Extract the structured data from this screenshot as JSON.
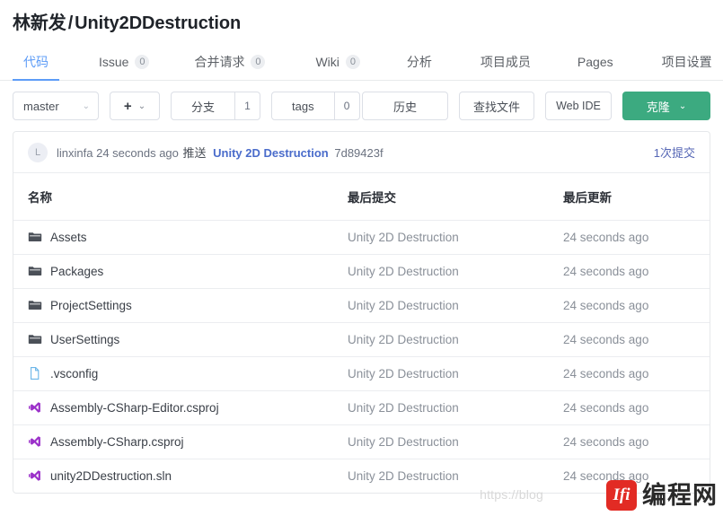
{
  "repo": {
    "owner": "林新发",
    "separator": "/",
    "name": "Unity2DDestruction"
  },
  "tabs": [
    {
      "label": "代码",
      "badge": null,
      "active": true
    },
    {
      "label": "Issue",
      "badge": "0",
      "active": false
    },
    {
      "label": "合并请求",
      "badge": "0",
      "active": false
    },
    {
      "label": "Wiki",
      "badge": "0",
      "active": false
    },
    {
      "label": "分析",
      "badge": null,
      "active": false
    },
    {
      "label": "项目成员",
      "badge": null,
      "active": false
    },
    {
      "label": "Pages",
      "badge": null,
      "active": false
    },
    {
      "label": "项目设置",
      "badge": null,
      "active": false
    }
  ],
  "toolbar": {
    "branch_value": "master",
    "branch_caret": "⌄",
    "add_plus": "+",
    "add_caret": "⌄",
    "branches_label": "分支",
    "branches_count": "1",
    "tags_label": "tags",
    "tags_count": "0",
    "history_label": "历史",
    "find_file_label": "查找文件",
    "web_ide_label": "Web IDE",
    "clone_label": "克隆",
    "clone_caret": "⌄",
    "clone_color": "#3caa80"
  },
  "commit_bar": {
    "avatar_initial": "L",
    "author": "linxinfa",
    "time": "24 seconds ago",
    "action": "推送",
    "message": "Unity 2D Destruction",
    "sha": "7d89423f",
    "commit_count": "1次提交"
  },
  "table": {
    "headers": {
      "name": "名称",
      "last_commit": "最后提交",
      "last_update": "最后更新"
    },
    "rows": [
      {
        "icon": "folder-icon",
        "name": "Assets",
        "last_commit": "Unity 2D Destruction",
        "last_update": "24 seconds ago"
      },
      {
        "icon": "folder-icon",
        "name": "Packages",
        "last_commit": "Unity 2D Destruction",
        "last_update": "24 seconds ago"
      },
      {
        "icon": "folder-icon",
        "name": "ProjectSettings",
        "last_commit": "Unity 2D Destruction",
        "last_update": "24 seconds ago"
      },
      {
        "icon": "folder-icon",
        "name": "UserSettings",
        "last_commit": "Unity 2D Destruction",
        "last_update": "24 seconds ago"
      },
      {
        "icon": "file-icon",
        "name": ".vsconfig",
        "last_commit": "Unity 2D Destruction",
        "last_update": "24 seconds ago"
      },
      {
        "icon": "vs-proj-icon",
        "name": "Assembly-CSharp-Editor.csproj",
        "last_commit": "Unity 2D Destruction",
        "last_update": "24 seconds ago"
      },
      {
        "icon": "vs-proj-icon",
        "name": "Assembly-CSharp.csproj",
        "last_commit": "Unity 2D Destruction",
        "last_update": "24 seconds ago"
      },
      {
        "icon": "vs-proj-icon",
        "name": "unity2DDestruction.sln",
        "last_commit": "Unity 2D Destruction",
        "last_update": "24 seconds ago"
      }
    ]
  },
  "watermark": {
    "url": "https://blog",
    "logo_text": "Ifi",
    "text": "编程网"
  }
}
